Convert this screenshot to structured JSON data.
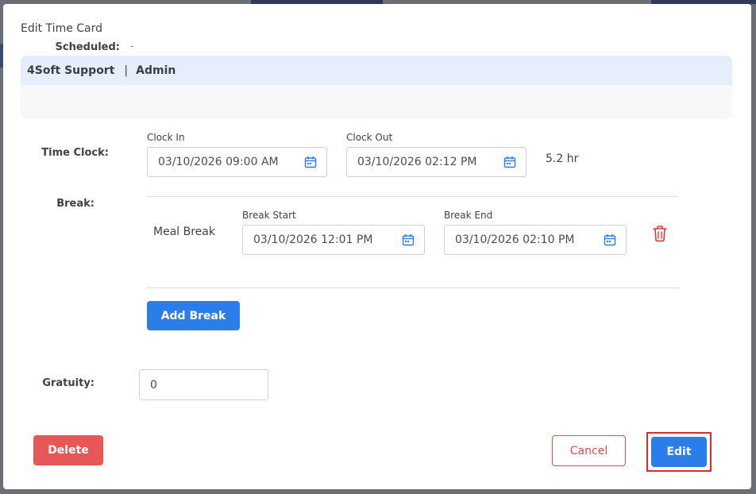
{
  "modal": {
    "title": "Edit Time Card"
  },
  "employee": {
    "name": "4Soft Support",
    "separator": "|",
    "role": "Admin"
  },
  "scheduled": {
    "label": "Scheduled:",
    "value": "-"
  },
  "time_clock": {
    "label": "Time Clock:",
    "clock_in_label": "Clock In",
    "clock_in_value": "03/10/2026 09:00 AM",
    "clock_out_label": "Clock Out",
    "clock_out_value": "03/10/2026 02:12 PM",
    "hours": "5.2 hr"
  },
  "break": {
    "label": "Break:",
    "items": [
      {
        "type": "Meal Break",
        "start_label": "Break Start",
        "start_value": "03/10/2026 12:01 PM",
        "end_label": "Break End",
        "end_value": "03/10/2026 02:10 PM"
      }
    ],
    "add_button": "Add Break"
  },
  "gratuity": {
    "label": "Gratuity:",
    "value": "0"
  },
  "actions": {
    "delete": "Delete",
    "cancel": "Cancel",
    "edit": "Edit"
  },
  "colors": {
    "primary": "#2b7de9",
    "danger": "#e85757",
    "highlight": "#e02929",
    "header_bg": "#e6eefb"
  },
  "icons": {
    "calendar": "calendar-icon",
    "delete": "trash-icon"
  }
}
